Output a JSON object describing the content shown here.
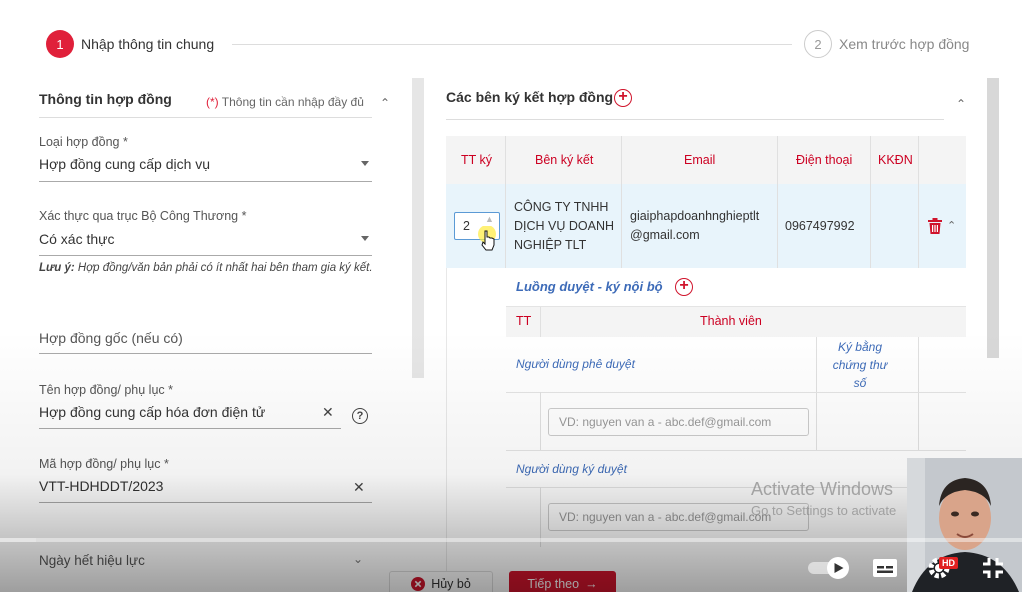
{
  "stepper": {
    "step1_number": "1",
    "step1_label": "Nhập thông tin chung",
    "step2_number": "2",
    "step2_label": "Xem trước hợp đồng"
  },
  "left": {
    "section_title": "Thông tin hợp đồng",
    "required_star": "(*)",
    "required_note": " Thông tin cần nhập đầy đủ",
    "contract_type_label": "Loại hợp đồng *",
    "contract_type_value": "Hợp đồng cung cấp dịch vụ",
    "verification_label": "Xác thực qua trục Bộ Công Thương *",
    "verification_value": "Có xác thực",
    "note_bold": "Lưu ý:",
    "note_text": " Hợp đồng/văn bản phải có ít nhất hai bên tham gia ký kết.",
    "original_contract_placeholder": "Hợp đồng gốc (nếu có)",
    "contract_name_label": "Tên hợp đồng/ phụ lục *",
    "contract_name_value": "Hợp đồng cung cấp hóa đơn điện tử",
    "contract_code_label": "Mã hợp đồng/ phụ lục *",
    "contract_code_value": "VTT-HDHDDT/2023",
    "expiry_label": "Ngày hết hiệu lực"
  },
  "right": {
    "title": "Các bên ký kết hợp đồng",
    "table_headers": [
      "TT ký",
      "Bên ký kết",
      "Email",
      "Điện thoại",
      "KKĐN"
    ],
    "row": {
      "order": "2",
      "party_line1": "CÔNG TY TNHH",
      "party_line2": "DỊCH VỤ DOANH",
      "party_line3": "NGHIỆP TLT",
      "email_line1": "giaiphapdoanhnghieptlt",
      "email_line2": "@gmail.com",
      "phone": "0967497992"
    },
    "flow_title": "Luồng duyệt - ký nội bộ",
    "sub_headers": [
      "TT",
      "Thành viên"
    ],
    "approver_label": "Người dùng phê duyệt",
    "signer_label": "Người dùng ký duyệt",
    "sign_cert_line1": "Ký bằng",
    "sign_cert_line2": "chứng thư",
    "sign_cert_line3": "số",
    "input_placeholder": "VD: nguyen van a - abc.def@gmail.com"
  },
  "buttons": {
    "cancel": "Hủy bỏ",
    "next": "Tiếp theo"
  },
  "overlay": {
    "watermark_title": "Activate Windows",
    "watermark_sub": "Go to Settings to activate",
    "progress_fraction": 0.035,
    "hd_badge": "HD"
  },
  "colors": {
    "brand_red": "#d0142c",
    "link_blue": "#3d6bb8",
    "selected_row": "#e8f4fb"
  }
}
